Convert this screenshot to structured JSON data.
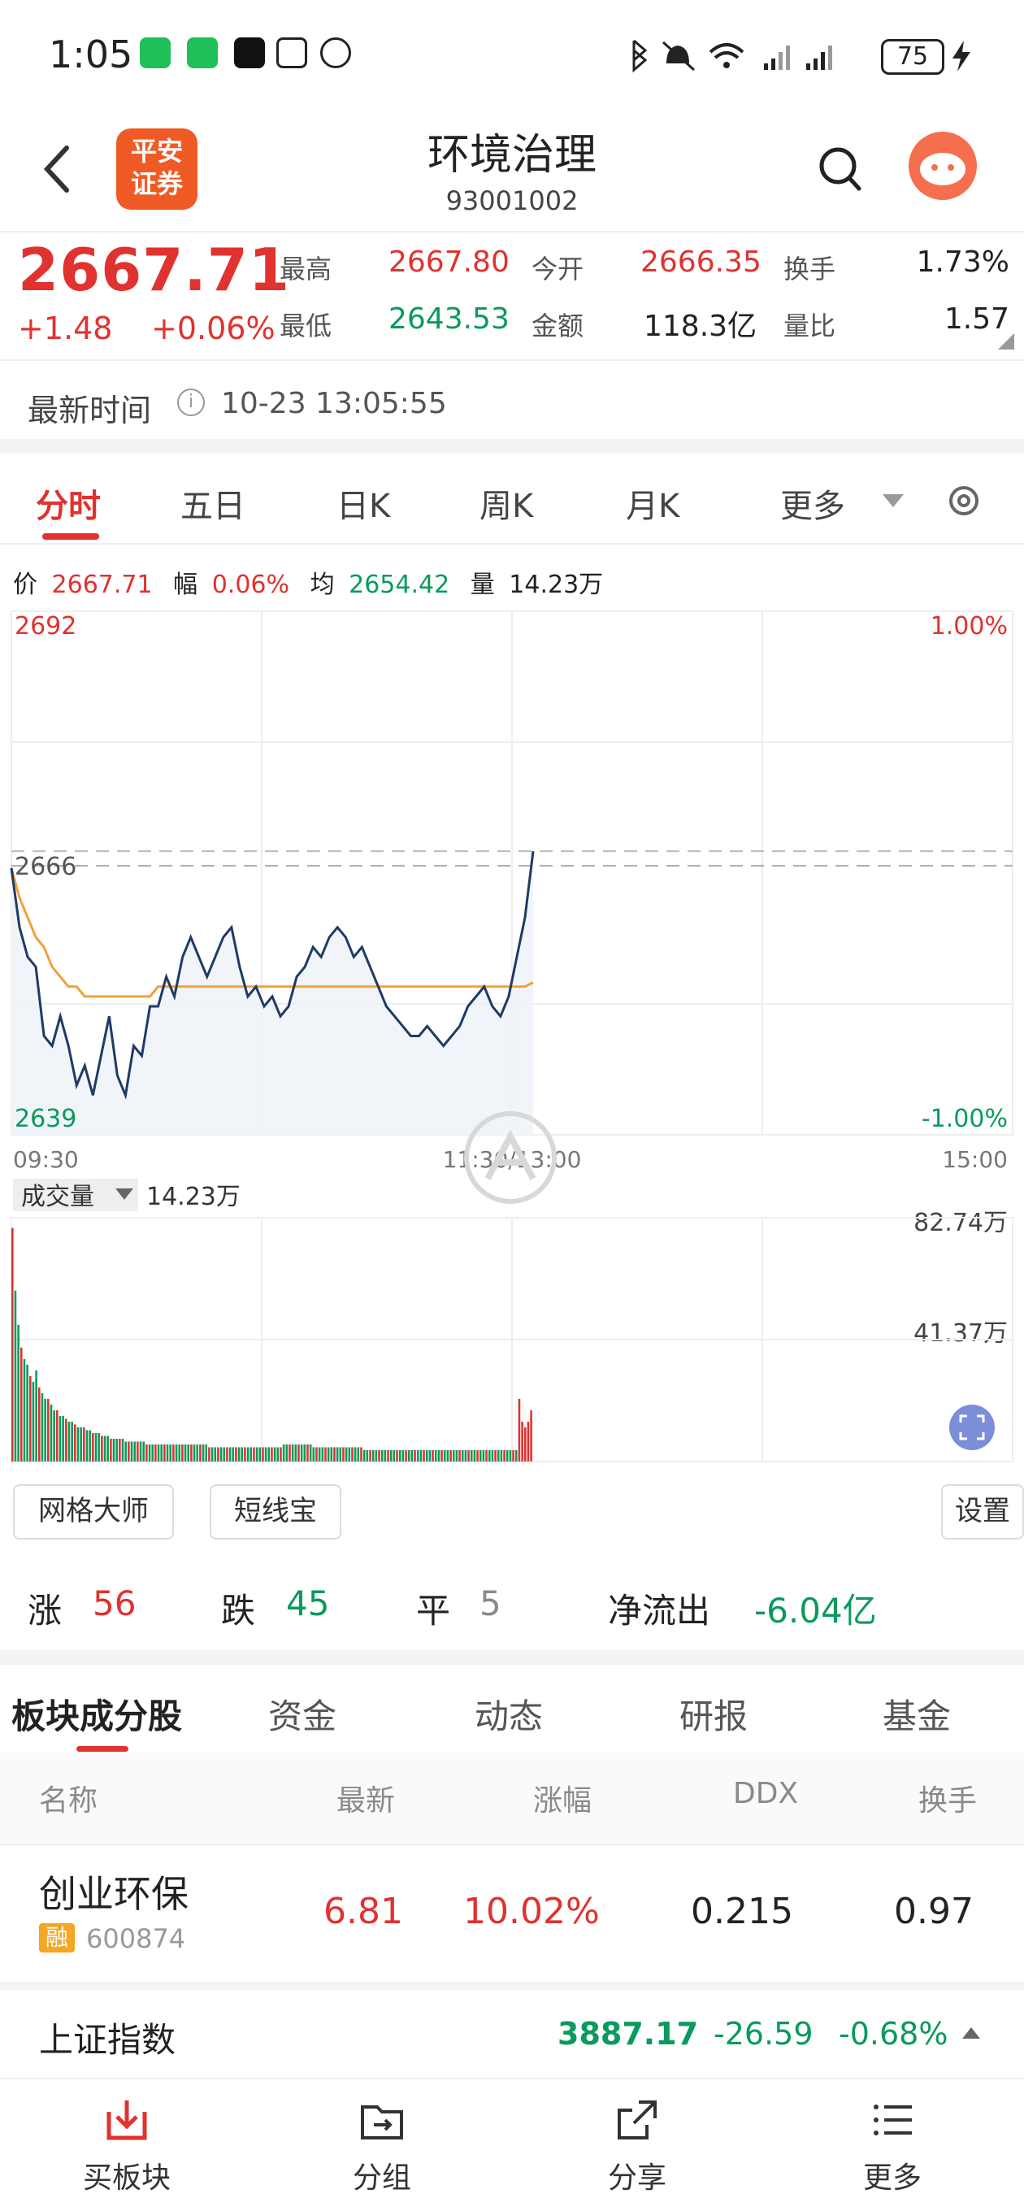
{
  "status": {
    "time": "1:05",
    "battery": "75"
  },
  "header": {
    "back_icon": "chevron-left-icon",
    "logo_text_1": "平安",
    "logo_text_2": "证券",
    "title": "环境治理",
    "code": "93001002"
  },
  "quote": {
    "price": "2667.71",
    "change": "+1.48",
    "change_pct": "+0.06%",
    "high_label": "最高",
    "high": "2667.80",
    "low_label": "最低",
    "low": "2643.53",
    "open_label": "今开",
    "open": "2666.35",
    "amount_label": "金额",
    "amount": "118.3亿",
    "turnover_label": "换手",
    "turnover": "1.73%",
    "vol_ratio_label": "量比",
    "vol_ratio": "1.57"
  },
  "update": {
    "label": "最新时间",
    "value": "10-23 13:05:55"
  },
  "chart_tabs": [
    "分时",
    "五日",
    "日K",
    "周K",
    "月K",
    "更多"
  ],
  "intraday_info": {
    "price_label": "价",
    "price": "2667.71",
    "amp_label": "幅",
    "amp": "0.06%",
    "avg_label": "均",
    "avg": "2654.42",
    "vol_label": "量",
    "vol": "14.23万"
  },
  "chart_data": {
    "type": "line",
    "y_max_label": "2692",
    "y_ref_label": "2666",
    "y_min_label": "2639",
    "pct_max_label": "1.00%",
    "pct_min_label": "-1.00%",
    "x_labels": [
      "09:30",
      "11:30/13:00",
      "15:00"
    ],
    "ylim": [
      2639,
      2692
    ],
    "series": [
      {
        "values": [
          2666,
          2660,
          2657,
          2656,
          2649,
          2648,
          2651,
          2648,
          2644,
          2646,
          2643,
          2647,
          2651,
          2645,
          2643,
          2648,
          2647,
          2652,
          2652,
          2655,
          2653,
          2657,
          2659,
          2657,
          2655,
          2657,
          2659,
          2660,
          2656,
          2653,
          2654,
          2652,
          2653,
          2651,
          2652,
          2655,
          2656,
          2658,
          2657,
          2659,
          2660,
          2659,
          2657,
          2658,
          2656,
          2654,
          2652,
          2651,
          2650,
          2649,
          2649,
          2650,
          2649,
          2648,
          2649,
          2650,
          2652,
          2653,
          2654,
          2652,
          2651,
          2653,
          2657,
          2661,
          2667.71
        ]
      },
      {
        "values": [
          2666,
          2663,
          2661,
          2659,
          2658,
          2656,
          2655,
          2654,
          2654,
          2653,
          2653,
          2653,
          2653,
          2653,
          2653,
          2653,
          2653,
          2653,
          2654,
          2654,
          2654,
          2654,
          2654,
          2654,
          2654,
          2654,
          2654,
          2654,
          2654,
          2654,
          2654,
          2654,
          2654,
          2654,
          2654,
          2654,
          2654,
          2654,
          2654,
          2654,
          2654,
          2654,
          2654,
          2654,
          2654,
          2654,
          2654,
          2654,
          2654,
          2654,
          2654,
          2654,
          2654,
          2654,
          2654,
          2654,
          2654,
          2654,
          2654,
          2654,
          2654,
          2654,
          2654,
          2654,
          2654.42
        ]
      }
    ]
  },
  "volume": {
    "label": "成交量",
    "value": "14.23万",
    "max_label": "82.74万",
    "mid_label": "41.37万",
    "bars": [
      82,
      60,
      48,
      40,
      36,
      34,
      30,
      28,
      32,
      26,
      24,
      22,
      22,
      20,
      18,
      18,
      16,
      16,
      15,
      14,
      14,
      13,
      12,
      12,
      12,
      11,
      11,
      10,
      10,
      10,
      9,
      9,
      9,
      8,
      8,
      8,
      8,
      8,
      7,
      7,
      7,
      7,
      7,
      7,
      7,
      6,
      6,
      6,
      6,
      6,
      6,
      6,
      6,
      6,
      6,
      6,
      6,
      6,
      6,
      6,
      6,
      6,
      6,
      6,
      6,
      6,
      5,
      5,
      5,
      5,
      5,
      5,
      5,
      5,
      5,
      5,
      5,
      5,
      5,
      5,
      5,
      5,
      5,
      5,
      5,
      5,
      5,
      5,
      5,
      5,
      5,
      6,
      6,
      6,
      6,
      6,
      6,
      6,
      6,
      6,
      6,
      5,
      5,
      5,
      5,
      5,
      5,
      5,
      5,
      5,
      5,
      5,
      5,
      5,
      5,
      5,
      5,
      5,
      4,
      4,
      4,
      4,
      4,
      4,
      4,
      4,
      4,
      4,
      4,
      4,
      4,
      4,
      4,
      4,
      4,
      4,
      4,
      4,
      4,
      4,
      4,
      4,
      4,
      4,
      4,
      4,
      4,
      4,
      4,
      4,
      4,
      4,
      4,
      4,
      4,
      4,
      4,
      4,
      4,
      4,
      4,
      4,
      4,
      4,
      4,
      4,
      4,
      4,
      4,
      4,
      22,
      14,
      12,
      14,
      18
    ]
  },
  "tools": {
    "grid": "网格大师",
    "short": "短线宝",
    "settings": "设置"
  },
  "stats": {
    "up_label": "涨",
    "up": "56",
    "down_label": "跌",
    "down": "45",
    "flat_label": "平",
    "flat": "5",
    "net_label": "净流出",
    "net": "-6.04亿"
  },
  "sub_tabs": [
    "板块成分股",
    "资金",
    "动态",
    "研报",
    "基金"
  ],
  "columns": [
    "名称",
    "最新",
    "涨幅",
    "DDX",
    "换手"
  ],
  "rows": [
    {
      "name": "创业环保",
      "tag": "融",
      "code": "600874",
      "price": "6.81",
      "pct": "10.02%",
      "ddx": "0.215",
      "turnover": "0.97"
    }
  ],
  "index_bar": {
    "name": "上证指数",
    "value": "3887.17",
    "change": "-26.59",
    "pct": "-0.68%"
  },
  "bottom_nav": [
    {
      "label": "买板块",
      "icon": "download-box-icon"
    },
    {
      "label": "分组",
      "icon": "folder-icon"
    },
    {
      "label": "分享",
      "icon": "share-icon"
    },
    {
      "label": "更多",
      "icon": "menu-list-icon"
    }
  ],
  "colors": {
    "up": "#e0322f",
    "down": "#0a9a5c",
    "price_line": "#1f3a66",
    "avg_line": "#f0a23a"
  }
}
